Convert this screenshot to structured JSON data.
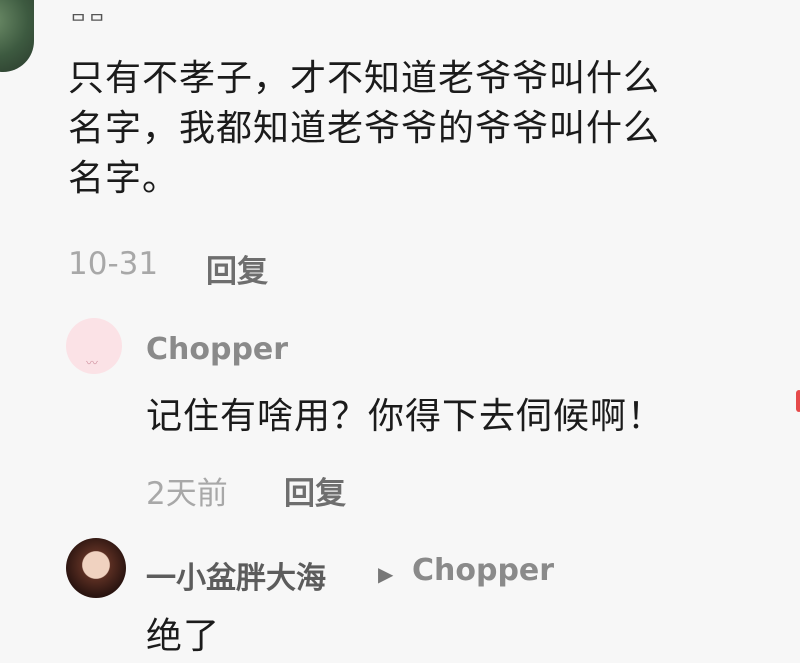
{
  "comments": [
    {
      "username": "ᄆᄆ",
      "text_lines": [
        "只有不孝子，才不知道老爷爷叫什么",
        "名字，我都知道老爷爷的爷爷叫什么",
        "名字。"
      ],
      "time": "10-31",
      "reply_label": "回复"
    },
    {
      "username": "Chopper",
      "text": "记住有啥用？你得下去伺候啊！",
      "time": "2天前",
      "reply_label": "回复"
    },
    {
      "username": "一小盆胖大海",
      "reply_to": "Chopper",
      "text": "绝了"
    }
  ],
  "icons": {
    "avatar_1": "avatar-photo",
    "avatar_2": "avatar-pink-placeholder",
    "avatar_3": "avatar-photo",
    "reply_arrow": "play-triangle-icon"
  },
  "colors": {
    "background": "#f7f7f7",
    "text": "#1b1b1b",
    "meta": "#a8a8a8",
    "username": "#8a8a8a"
  }
}
